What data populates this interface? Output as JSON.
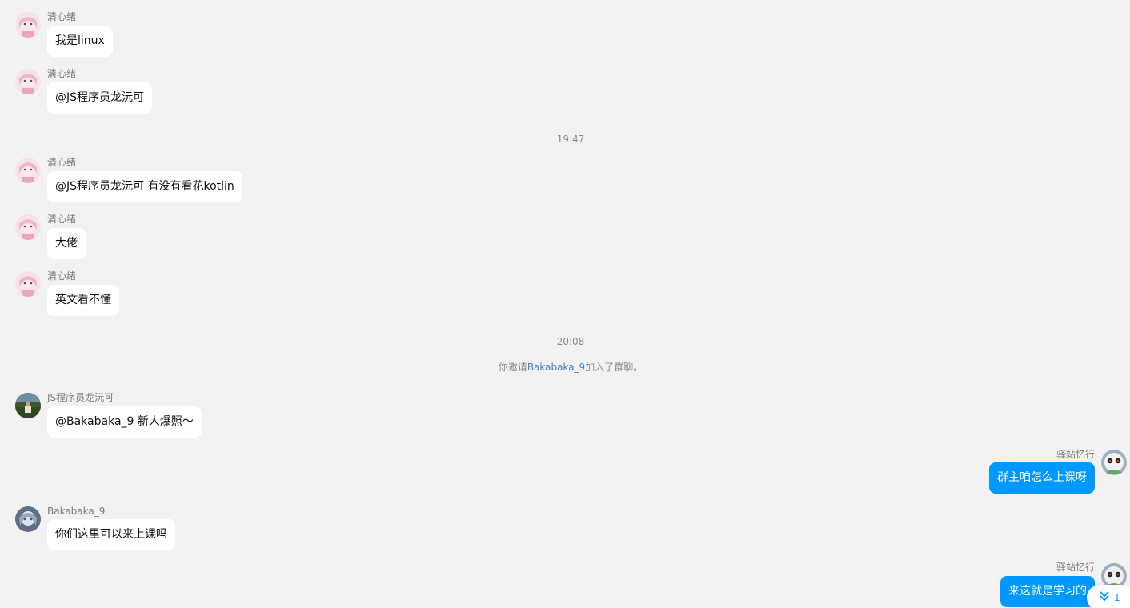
{
  "messages": [
    {
      "sender": "清心绪",
      "text": "我是linux"
    },
    {
      "sender": "清心绪",
      "text": "@JS程序员龙沅可"
    },
    {
      "sender": "清心绪",
      "text": "@JS程序员龙沅可 有没有看花kotlin"
    },
    {
      "sender": "清心绪",
      "text": "大佬"
    },
    {
      "sender": "清心绪",
      "text": "英文看不懂"
    },
    {
      "sender": "JS程序员龙沅可",
      "text": "@Bakabaka_9 新人爆照～"
    },
    {
      "sender": "驿站忆行",
      "text": "群主咱怎么上课呀"
    },
    {
      "sender": "Bakabaka_9",
      "text": "你们这里可以来上课吗"
    },
    {
      "sender": "驿站忆行",
      "text": "来这就是学习的"
    }
  ],
  "time_separators": [
    "19:47",
    "20:08"
  ],
  "system_notice": {
    "prefix": "你邀请",
    "user": "Bakabaka_9",
    "suffix": "加入了群聊。"
  },
  "new_message_indicator": {
    "count": "1",
    "icon": "double-chevron-down-icon"
  },
  "avatars": {
    "qingxinxu": "anime-girl-avatar",
    "js": "landscape-avatar",
    "yizhan": "cat-avatar",
    "bakabaka": "anime-avatar"
  },
  "colors": {
    "background": "#f2f2f2",
    "self_bubble": "#0099ff",
    "other_bubble": "#ffffff",
    "link": "#3f7fcf"
  }
}
